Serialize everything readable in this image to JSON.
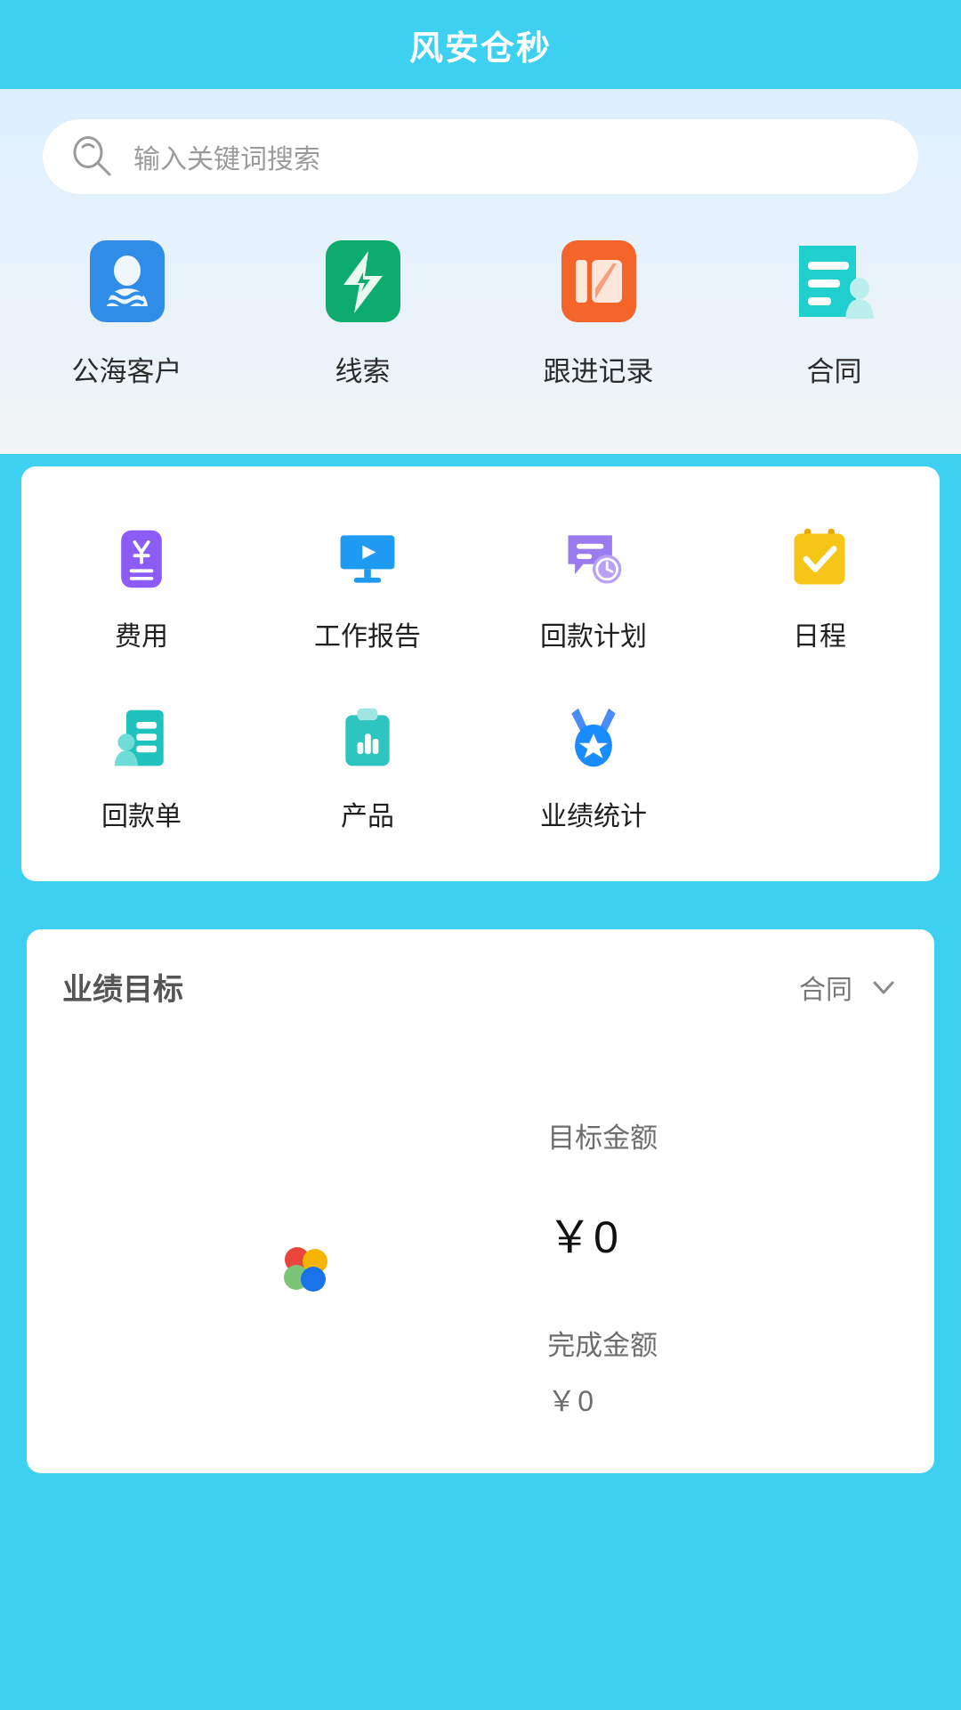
{
  "header": {
    "title": "风安仓秒",
    "background_color": "#3ed0f0"
  },
  "search": {
    "placeholder": "输入关键词搜索",
    "icon": "search-icon"
  },
  "quick_nav": {
    "items": [
      {
        "label": "公海客户",
        "icon": "public-customer-icon",
        "color": "#2f8de8"
      },
      {
        "label": "线索",
        "icon": "lead-bolt-icon",
        "color": "#10b981"
      },
      {
        "label": "跟进记录",
        "icon": "follow-up-note-icon",
        "color": "#f3652b"
      },
      {
        "label": "合同",
        "icon": "contract-person-icon",
        "color": "#22cfcf"
      }
    ]
  },
  "features": {
    "rows": [
      [
        {
          "label": "费用",
          "icon": "expense-yen-icon",
          "color": "#8b5cf6"
        },
        {
          "label": "工作报告",
          "icon": "work-report-monitor-icon",
          "color": "#1e9bf0"
        },
        {
          "label": "回款计划",
          "icon": "payment-plan-clock-icon",
          "color": "#9b7cf0"
        },
        {
          "label": "日程",
          "icon": "schedule-calendar-icon",
          "color": "#f5c518"
        }
      ],
      [
        {
          "label": "回款单",
          "icon": "payment-receipt-icon",
          "color": "#1fc2bd"
        },
        {
          "label": "产品",
          "icon": "product-clipboard-icon",
          "color": "#2ec5c0"
        },
        {
          "label": "业绩统计",
          "icon": "performance-medal-icon",
          "color": "#1a8cff"
        }
      ]
    ]
  },
  "goal_card": {
    "title": "业绩目标",
    "filter_label": "合同",
    "filter_icon": "chevron-down-icon",
    "loading_icon": "four-dot-spinner",
    "target_caption": "目标金额",
    "target_amount": "￥0",
    "completed_caption": "完成金额",
    "completed_amount": "￥0"
  }
}
